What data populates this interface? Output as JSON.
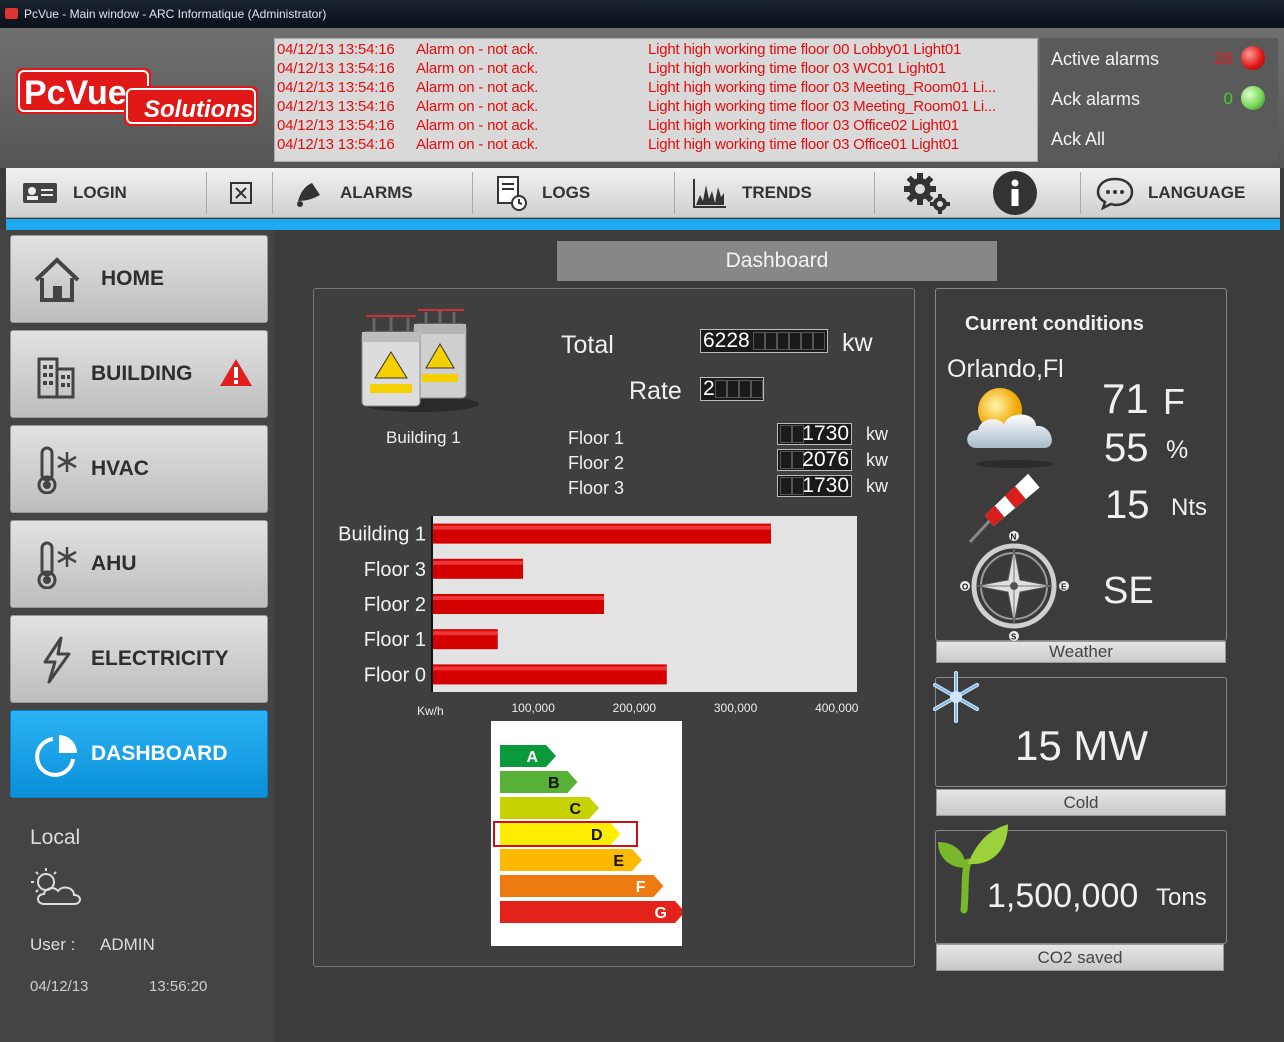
{
  "window": {
    "title": "PcVue - Main window - ARC Informatique (Administrator)"
  },
  "logo": {
    "brand": "PcVue",
    "sub": "Solutions"
  },
  "alarms": [
    {
      "time": "04/12/13 13:54:16",
      "state": "Alarm on - not ack.",
      "text": "Light high working time floor 00 Lobby01 Light01"
    },
    {
      "time": "04/12/13 13:54:16",
      "state": "Alarm on - not ack.",
      "text": "Light high working time floor 03 WC01 Light01"
    },
    {
      "time": "04/12/13 13:54:16",
      "state": "Alarm on - not ack.",
      "text": "Light high working time floor 03 Meeting_Room01 Li..."
    },
    {
      "time": "04/12/13 13:54:16",
      "state": "Alarm on - not ack.",
      "text": "Light high working time floor 03 Meeting_Room01 Li..."
    },
    {
      "time": "04/12/13 13:54:16",
      "state": "Alarm on - not ack.",
      "text": "Light high working time floor 03 Office02 Light01"
    },
    {
      "time": "04/12/13 13:54:16",
      "state": "Alarm on - not ack.",
      "text": "Light high working time floor 03 Office01 Light01"
    }
  ],
  "alarm_status": {
    "active_label": "Active alarms",
    "active_count": "28",
    "active_color": "#e31b1b",
    "ack_label": "Ack alarms",
    "ack_count": "0",
    "ack_color": "#3fd12b",
    "ack_all_label": "Ack All"
  },
  "toolbar": {
    "login": "LOGIN",
    "alarms": "ALARMS",
    "logs": "LOGS",
    "trends": "TRENDS",
    "language": "LANGUAGE"
  },
  "sidebar": {
    "items": [
      {
        "label": "HOME",
        "icon": "home-icon"
      },
      {
        "label": "BUILDING",
        "icon": "building-icon"
      },
      {
        "label": "HVAC",
        "icon": "thermometer-snow-icon"
      },
      {
        "label": "AHU",
        "icon": "thermometer-snow-icon"
      },
      {
        "label": "ELECTRICITY",
        "icon": "lightning-icon"
      },
      {
        "label": "DASHBOARD",
        "icon": "dashboard-icon"
      }
    ],
    "location": "Local",
    "user_label": "User :",
    "user": "ADMIN",
    "date": "04/12/13",
    "time": "13:56:20"
  },
  "dashboard": {
    "title": "Dashboard",
    "building_label": "Building 1",
    "total_label": "Total",
    "total_value": "6228",
    "total_unit": "kw",
    "rate_label": "Rate",
    "rate_value": "2",
    "floors": [
      {
        "label": "Floor 1",
        "value": "1730",
        "unit": "kw"
      },
      {
        "label": "Floor 2",
        "value": "2076",
        "unit": "kw"
      },
      {
        "label": "Floor 3",
        "value": "1730",
        "unit": "kw"
      }
    ],
    "energy_classes": [
      "A",
      "B",
      "C",
      "D",
      "E",
      "F",
      "G"
    ],
    "energy_colors": [
      "#0a9a3c",
      "#56b136",
      "#c6d300",
      "#ffed00",
      "#fbba00",
      "#ee7a12",
      "#e3231b"
    ],
    "energy_selected": "D"
  },
  "chart_data": {
    "type": "bar",
    "orientation": "horizontal",
    "categories": [
      "Building 1",
      "Floor 3",
      "Floor 2",
      "Floor 1",
      "Floor 0"
    ],
    "values": [
      335000,
      90000,
      170000,
      65000,
      232000
    ],
    "xlabel": "Kw/h",
    "xticks": [
      "100,000",
      "200,000",
      "300,000",
      "400,000"
    ],
    "xlim": [
      0,
      420000
    ],
    "bar_color": "#d40000",
    "grid": false
  },
  "weather": {
    "title": "Current conditions",
    "city": "Orlando,Fl",
    "temp": "71",
    "temp_unit": "F",
    "humidity": "55",
    "humidity_unit": "%",
    "wind": "15",
    "wind_unit": "Nts",
    "direction": "SE",
    "compass": {
      "n": "N",
      "s": "S",
      "e": "E",
      "o": "O"
    },
    "caption": "Weather"
  },
  "cold": {
    "value": "15 MW",
    "caption": "Cold"
  },
  "co2": {
    "value": "1,500,000",
    "unit": "Tons",
    "caption": "CO2  saved"
  }
}
